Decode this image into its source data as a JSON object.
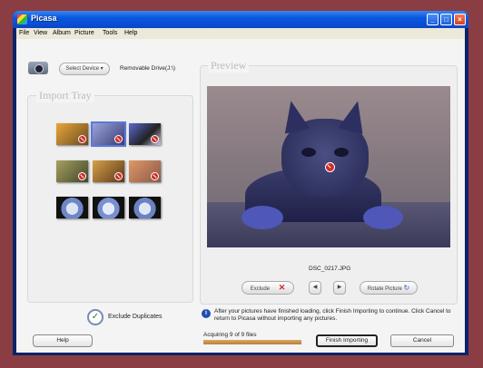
{
  "window": {
    "title": "Picasa"
  },
  "menu": [
    "File",
    "View",
    "Album",
    "Picture",
    "Tools",
    "Help"
  ],
  "device": {
    "select_label": "Select Device",
    "drive_label": "Removable Drive(J:\\)"
  },
  "import_tray": {
    "title": "Import Tray"
  },
  "preview": {
    "title": "Preview",
    "filename": "DSC_0217.JPG"
  },
  "controls": {
    "exclude_label": "Exclude",
    "rotate_label": "Rotate Picture"
  },
  "options": {
    "exclude_duplicates_label": "Exclude Duplicates"
  },
  "info": {
    "message": "After your pictures have finished loading, click Finish Importing to continue. Click Cancel to return to Picasa without importing any pictures."
  },
  "status": {
    "acquiring_text": "Acquiring 9 of 9 files",
    "progress": 1.0
  },
  "buttons": {
    "help_label": "Help",
    "finish_label": "Finish Importing",
    "cancel_label": "Cancel"
  },
  "colors": {
    "title_bar": "#0a46c8",
    "exclude_mark": "#d02828",
    "progress_fill": "#c89048"
  }
}
